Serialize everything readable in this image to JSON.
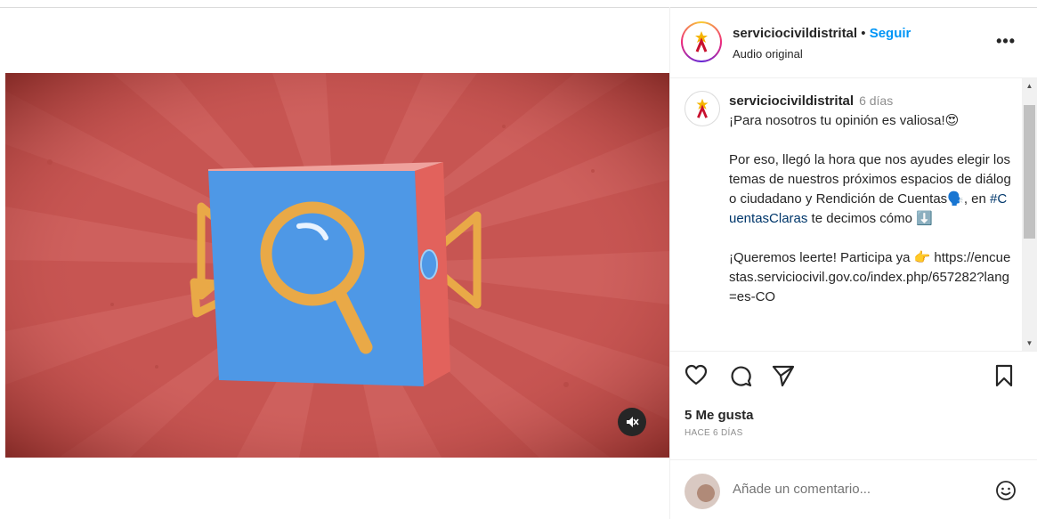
{
  "header": {
    "username": "serviciocivildistrital",
    "separator": "•",
    "follow_label": "Seguir",
    "subtitle": "Audio original",
    "more_label": "•••"
  },
  "caption": {
    "username": "serviciocivildistrital",
    "time": "6 días",
    "line1": "¡Para nosotros tu opinión es valiosa!😍",
    "paragraph2_a": "Por eso, llegó la hora que nos ayudes elegir los temas de nuestros próximos espacios de diálogo ciudadano y Rendición de Cuentas🗣️, en ",
    "hashtag": "#CuentasClaras",
    "paragraph2_b": " te decimos cómo ⬇️",
    "paragraph3": "¡Queremos leerte! Participa ya 👉 https://encuestas.serviciocivil.gov.co/index.php/657282?lang=es-CO"
  },
  "actions": {
    "likes": "5 Me gusta",
    "age": "HACE 6 DÍAS"
  },
  "comment": {
    "placeholder": "Añade un comentario..."
  },
  "icons": {
    "like": "heart-icon",
    "comment": "comment-icon",
    "share": "paper-plane-icon",
    "save": "bookmark-icon",
    "mute": "speaker-muted-icon",
    "emoji": "smiley-icon",
    "more": "ellipsis-icon"
  },
  "colors": {
    "background_red": "#c75552",
    "cube_blue": "#4e98e6",
    "cube_side": "#e2625c",
    "accent_yellow": "#e9a947",
    "follow_blue": "#0095f6"
  }
}
